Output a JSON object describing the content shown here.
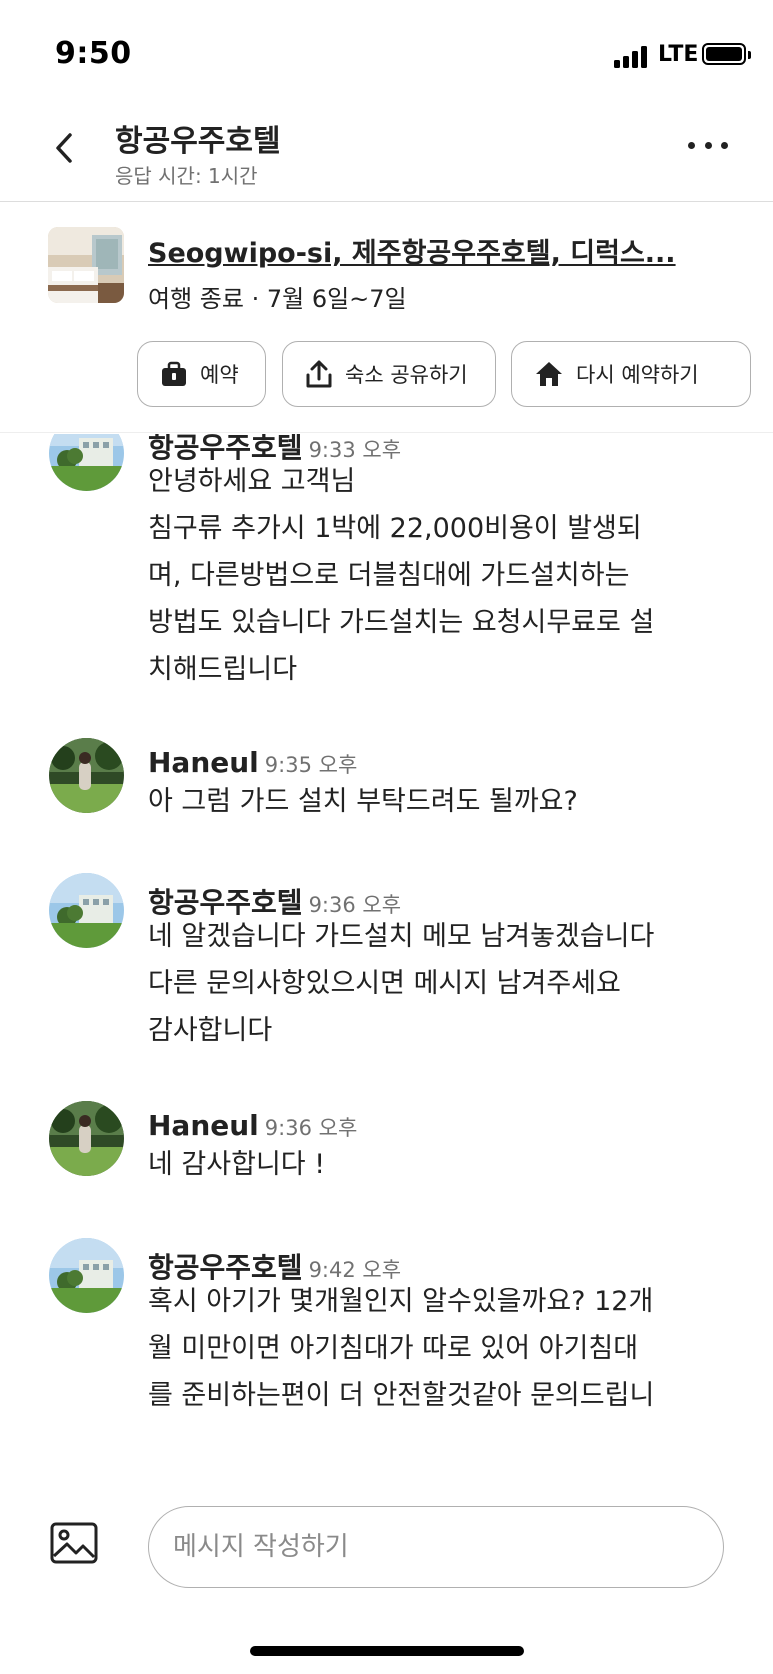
{
  "status_bar": {
    "time": "9:50",
    "network": "LTE"
  },
  "header": {
    "title": "항공우주호텔",
    "subtitle": "응답 시간: 1시간",
    "back_icon": "chevron-left-icon",
    "more_icon": "more-horizontal-icon"
  },
  "booking": {
    "title": "Seogwipo-si, 제주항공우주호텔, 디럭스...",
    "subtitle": "여행 종료 · 7월 6일~7일",
    "actions": [
      {
        "label": "예약",
        "icon": "briefcase-icon"
      },
      {
        "label": "숙소 공유하기",
        "icon": "share-icon"
      },
      {
        "label": "다시 예약하기",
        "icon": "home-icon"
      }
    ]
  },
  "messages": [
    {
      "sender": "항공우주호텔",
      "time": "9:33 오후",
      "text": "안녕하세요 고객님\n침구류 추가시 1박에 22,000비용이 발생되\n며, 다른방법으로 더블침대에 가드설치하는\n방법도 있습니다 가드설치는 요청시무료로 설\n치해드립니다"
    },
    {
      "sender": "Haneul",
      "time": "9:35 오후",
      "text": "아 그럼 가드 설치 부탁드려도 될까요?"
    },
    {
      "sender": "항공우주호텔",
      "time": "9:36 오후",
      "text": "네 알겠습니다 가드설치 메모 남겨놓겠습니다\n다른 문의사항있으시면 메시지 남겨주세요\n감사합니다"
    },
    {
      "sender": "Haneul",
      "time": "9:36 오후",
      "text": "네 감사합니다 !"
    },
    {
      "sender": "항공우주호텔",
      "time": "9:42 오후",
      "text": "혹시 아기가 몇개월인지 알수있을까요? 12개\n월 미만이면 아기침대가 따로 있어 아기침대\n를 준비하는편이 더 안전할것같아 문의드립니"
    }
  ],
  "composer": {
    "placeholder": "메시지 작성하기",
    "image_icon": "image-icon"
  }
}
